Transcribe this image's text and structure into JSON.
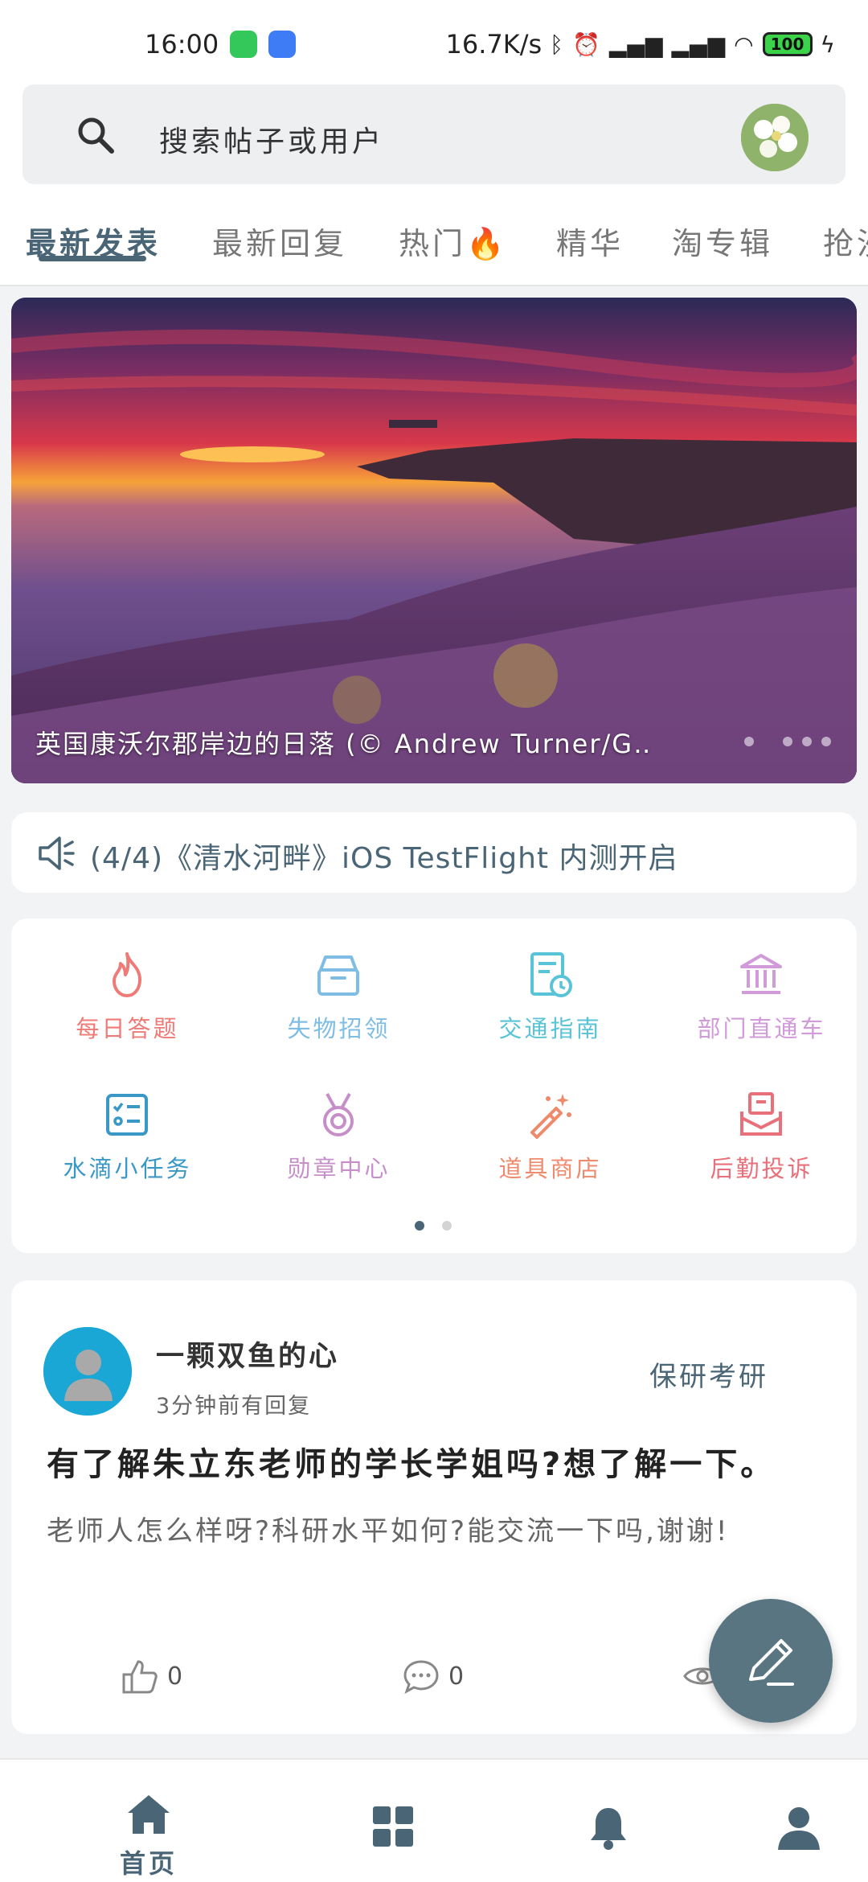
{
  "status_bar": {
    "time": "16:00",
    "network_speed": "16.7K/s",
    "battery": "100"
  },
  "search": {
    "placeholder": "搜索帖子或用户"
  },
  "tabs": [
    {
      "label": "最新发表",
      "active": true
    },
    {
      "label": "最新回复"
    },
    {
      "label": "热门🔥"
    },
    {
      "label": "精华"
    },
    {
      "label": "淘专辑"
    },
    {
      "label": "抢沙"
    }
  ],
  "banner": {
    "caption": "英国康沃尔郡岸边的日落 (© Andrew Turner/G‥"
  },
  "notice": {
    "text": "(4/4)《清水河畔》iOS TestFlight 内测开启"
  },
  "grid": [
    {
      "label": "每日答题",
      "icon": "fire-icon",
      "color": "#ee7b77"
    },
    {
      "label": "失物招领",
      "icon": "box-icon",
      "color": "#7fbde4"
    },
    {
      "label": "交通指南",
      "icon": "schedule-icon",
      "color": "#59c3d8"
    },
    {
      "label": "部门直通车",
      "icon": "bank-icon",
      "color": "#d19ad8"
    },
    {
      "label": "水滴小任务",
      "icon": "checklist-icon",
      "color": "#3a98c6"
    },
    {
      "label": "勋章中心",
      "icon": "medal-icon",
      "color": "#c78fc9"
    },
    {
      "label": "道具商店",
      "icon": "magic-wand-icon",
      "color": "#ef8a6d"
    },
    {
      "label": "后勤投诉",
      "icon": "mailbox-icon",
      "color": "#e8707a"
    }
  ],
  "colors": {
    "accent": "#4a6576",
    "fab": "#587581",
    "grid_dot_active": "#4a6576",
    "grid_dot_inactive": "#d4d4d4"
  },
  "post": {
    "author": "一颗双鱼的心",
    "time": "3分钟前有回复",
    "tag": "保研考研",
    "title": "有了解朱立东老师的学长学姐吗?想了解一下。",
    "body": "老师人怎么样呀?科研水平如何?能交流一下吗,谢谢!",
    "likes": "0",
    "comments": "0"
  },
  "bottom_nav": [
    {
      "label": "首页",
      "icon": "home-icon",
      "active": true
    },
    {
      "label": "",
      "icon": "grid-icon"
    },
    {
      "label": "",
      "icon": "bell-icon"
    },
    {
      "label": "",
      "icon": "user-icon"
    }
  ]
}
